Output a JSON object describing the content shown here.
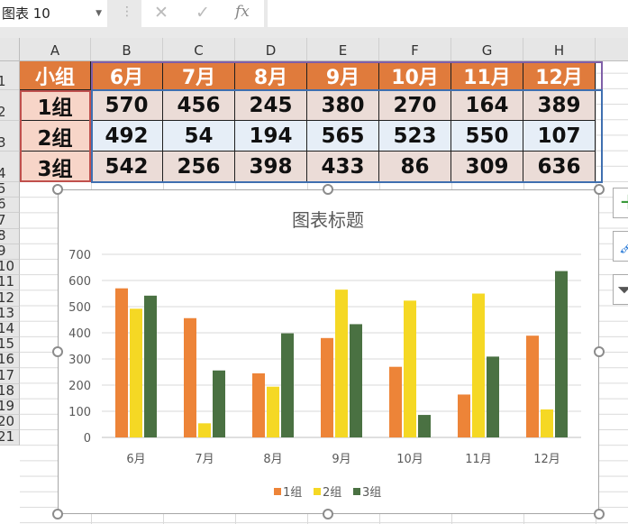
{
  "formula_bar": {
    "name_box": "图表 10",
    "cancel_icon": "✕",
    "enter_icon": "✓",
    "fx_label": "fx",
    "formula": ""
  },
  "columns": [
    "A",
    "B",
    "C",
    "D",
    "E",
    "F",
    "G",
    "H"
  ],
  "rows": [
    "1",
    "2",
    "3",
    "4",
    "5",
    "6",
    "7",
    "8",
    "9",
    "10",
    "11",
    "12",
    "13",
    "14",
    "15",
    "16",
    "17",
    "18",
    "19",
    "20",
    "21"
  ],
  "table": {
    "header": [
      "小组",
      "6月",
      "7月",
      "8月",
      "9月",
      "10月",
      "11月",
      "12月"
    ],
    "rows": [
      [
        "1组",
        "570",
        "456",
        "245",
        "380",
        "270",
        "164",
        "389"
      ],
      [
        "2组",
        "492",
        "54",
        "194",
        "565",
        "523",
        "550",
        "107"
      ],
      [
        "3组",
        "542",
        "256",
        "398",
        "433",
        "86",
        "309",
        "636"
      ]
    ]
  },
  "colors": {
    "header": "#E07B3C",
    "series": [
      "#ED8438",
      "#F5D824",
      "#4A7142"
    ]
  },
  "chart_data": {
    "type": "bar",
    "title": "图表标题",
    "categories": [
      "6月",
      "7月",
      "8月",
      "9月",
      "10月",
      "11月",
      "12月"
    ],
    "series": [
      {
        "name": "1组",
        "values": [
          570,
          456,
          245,
          380,
          270,
          164,
          389
        ]
      },
      {
        "name": "2组",
        "values": [
          492,
          54,
          194,
          565,
          523,
          550,
          107
        ]
      },
      {
        "name": "3组",
        "values": [
          542,
          256,
          398,
          433,
          86,
          309,
          636
        ]
      }
    ],
    "ylim": [
      0,
      700
    ],
    "yticks": [
      "0",
      "100",
      "200",
      "300",
      "400",
      "500",
      "600",
      "700"
    ],
    "grid": true,
    "legend": "bottom"
  },
  "chart_tools": [
    "chart-elements-icon",
    "chart-styles-icon",
    "chart-filters-icon"
  ]
}
